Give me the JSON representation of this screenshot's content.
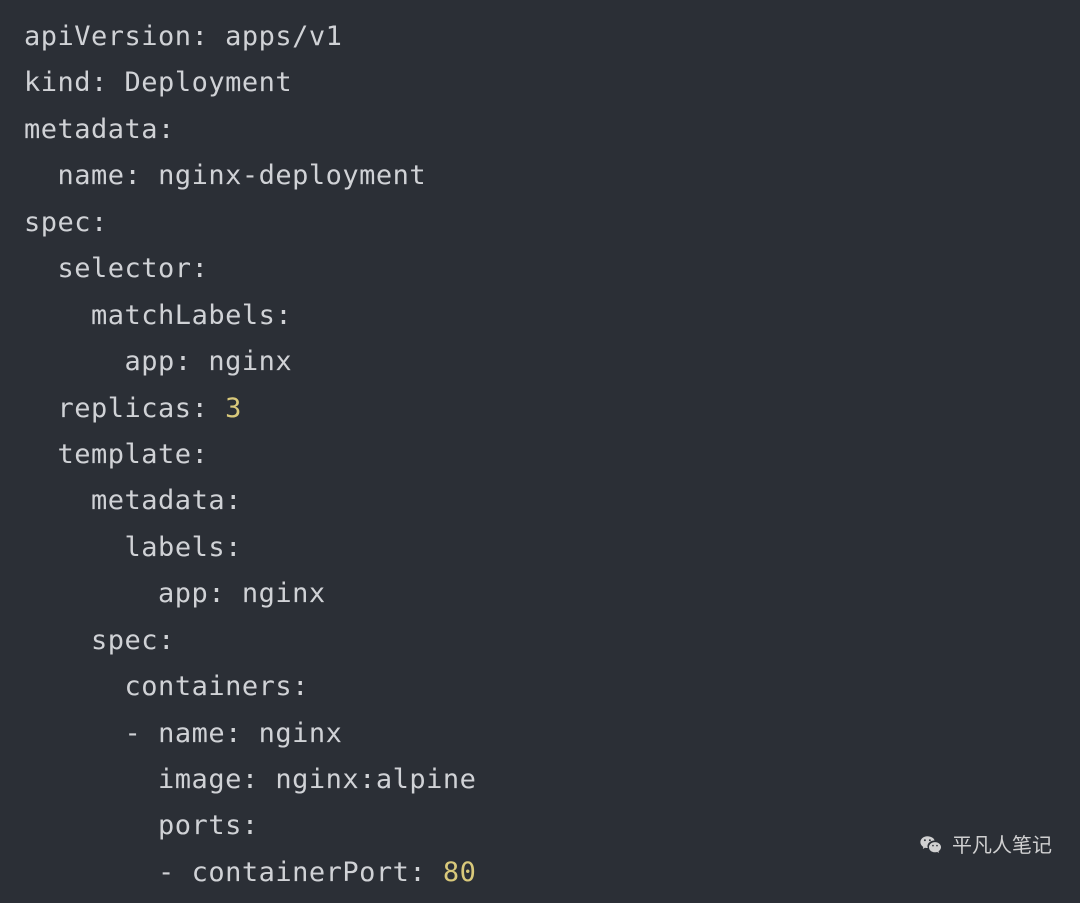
{
  "yaml": {
    "apiVersion_key": "apiVersion",
    "apiVersion_val": "apps/v1",
    "kind_key": "kind",
    "kind_val": "Deployment",
    "metadata_key": "metadata",
    "metadata_name_key": "name",
    "metadata_name_val": "nginx-deployment",
    "spec_key": "spec",
    "selector_key": "selector",
    "matchLabels_key": "matchLabels",
    "app_key": "app",
    "app_val": "nginx",
    "replicas_key": "replicas",
    "replicas_val": "3",
    "template_key": "template",
    "t_metadata_key": "metadata",
    "t_labels_key": "labels",
    "t_app_key": "app",
    "t_app_val": "nginx",
    "t_spec_key": "spec",
    "containers_key": "containers",
    "c_name_key": "name",
    "c_name_val": "nginx",
    "c_image_key": "image",
    "c_image_val": "nginx:alpine",
    "c_ports_key": "ports",
    "containerPort_key": "containerPort",
    "containerPort_val": "80"
  },
  "watermark": {
    "text": "平凡人笔记"
  }
}
